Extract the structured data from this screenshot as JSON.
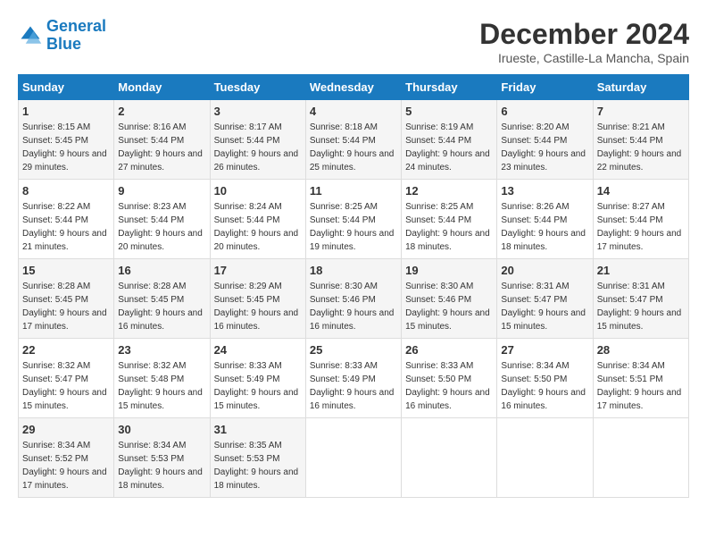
{
  "logo": {
    "line1": "General",
    "line2": "Blue"
  },
  "title": "December 2024",
  "subtitle": "Irueste, Castille-La Mancha, Spain",
  "days_of_week": [
    "Sunday",
    "Monday",
    "Tuesday",
    "Wednesday",
    "Thursday",
    "Friday",
    "Saturday"
  ],
  "weeks": [
    [
      {
        "day": "1",
        "sunrise": "8:15 AM",
        "sunset": "5:45 PM",
        "daylight": "9 hours and 29 minutes."
      },
      {
        "day": "2",
        "sunrise": "8:16 AM",
        "sunset": "5:44 PM",
        "daylight": "9 hours and 27 minutes."
      },
      {
        "day": "3",
        "sunrise": "8:17 AM",
        "sunset": "5:44 PM",
        "daylight": "9 hours and 26 minutes."
      },
      {
        "day": "4",
        "sunrise": "8:18 AM",
        "sunset": "5:44 PM",
        "daylight": "9 hours and 25 minutes."
      },
      {
        "day": "5",
        "sunrise": "8:19 AM",
        "sunset": "5:44 PM",
        "daylight": "9 hours and 24 minutes."
      },
      {
        "day": "6",
        "sunrise": "8:20 AM",
        "sunset": "5:44 PM",
        "daylight": "9 hours and 23 minutes."
      },
      {
        "day": "7",
        "sunrise": "8:21 AM",
        "sunset": "5:44 PM",
        "daylight": "9 hours and 22 minutes."
      }
    ],
    [
      {
        "day": "8",
        "sunrise": "8:22 AM",
        "sunset": "5:44 PM",
        "daylight": "9 hours and 21 minutes."
      },
      {
        "day": "9",
        "sunrise": "8:23 AM",
        "sunset": "5:44 PM",
        "daylight": "9 hours and 20 minutes."
      },
      {
        "day": "10",
        "sunrise": "8:24 AM",
        "sunset": "5:44 PM",
        "daylight": "9 hours and 20 minutes."
      },
      {
        "day": "11",
        "sunrise": "8:25 AM",
        "sunset": "5:44 PM",
        "daylight": "9 hours and 19 minutes."
      },
      {
        "day": "12",
        "sunrise": "8:25 AM",
        "sunset": "5:44 PM",
        "daylight": "9 hours and 18 minutes."
      },
      {
        "day": "13",
        "sunrise": "8:26 AM",
        "sunset": "5:44 PM",
        "daylight": "9 hours and 18 minutes."
      },
      {
        "day": "14",
        "sunrise": "8:27 AM",
        "sunset": "5:44 PM",
        "daylight": "9 hours and 17 minutes."
      }
    ],
    [
      {
        "day": "15",
        "sunrise": "8:28 AM",
        "sunset": "5:45 PM",
        "daylight": "9 hours and 17 minutes."
      },
      {
        "day": "16",
        "sunrise": "8:28 AM",
        "sunset": "5:45 PM",
        "daylight": "9 hours and 16 minutes."
      },
      {
        "day": "17",
        "sunrise": "8:29 AM",
        "sunset": "5:45 PM",
        "daylight": "9 hours and 16 minutes."
      },
      {
        "day": "18",
        "sunrise": "8:30 AM",
        "sunset": "5:46 PM",
        "daylight": "9 hours and 16 minutes."
      },
      {
        "day": "19",
        "sunrise": "8:30 AM",
        "sunset": "5:46 PM",
        "daylight": "9 hours and 15 minutes."
      },
      {
        "day": "20",
        "sunrise": "8:31 AM",
        "sunset": "5:47 PM",
        "daylight": "9 hours and 15 minutes."
      },
      {
        "day": "21",
        "sunrise": "8:31 AM",
        "sunset": "5:47 PM",
        "daylight": "9 hours and 15 minutes."
      }
    ],
    [
      {
        "day": "22",
        "sunrise": "8:32 AM",
        "sunset": "5:47 PM",
        "daylight": "9 hours and 15 minutes."
      },
      {
        "day": "23",
        "sunrise": "8:32 AM",
        "sunset": "5:48 PM",
        "daylight": "9 hours and 15 minutes."
      },
      {
        "day": "24",
        "sunrise": "8:33 AM",
        "sunset": "5:49 PM",
        "daylight": "9 hours and 15 minutes."
      },
      {
        "day": "25",
        "sunrise": "8:33 AM",
        "sunset": "5:49 PM",
        "daylight": "9 hours and 16 minutes."
      },
      {
        "day": "26",
        "sunrise": "8:33 AM",
        "sunset": "5:50 PM",
        "daylight": "9 hours and 16 minutes."
      },
      {
        "day": "27",
        "sunrise": "8:34 AM",
        "sunset": "5:50 PM",
        "daylight": "9 hours and 16 minutes."
      },
      {
        "day": "28",
        "sunrise": "8:34 AM",
        "sunset": "5:51 PM",
        "daylight": "9 hours and 17 minutes."
      }
    ],
    [
      {
        "day": "29",
        "sunrise": "8:34 AM",
        "sunset": "5:52 PM",
        "daylight": "9 hours and 17 minutes."
      },
      {
        "day": "30",
        "sunrise": "8:34 AM",
        "sunset": "5:53 PM",
        "daylight": "9 hours and 18 minutes."
      },
      {
        "day": "31",
        "sunrise": "8:35 AM",
        "sunset": "5:53 PM",
        "daylight": "9 hours and 18 minutes."
      },
      null,
      null,
      null,
      null
    ]
  ]
}
